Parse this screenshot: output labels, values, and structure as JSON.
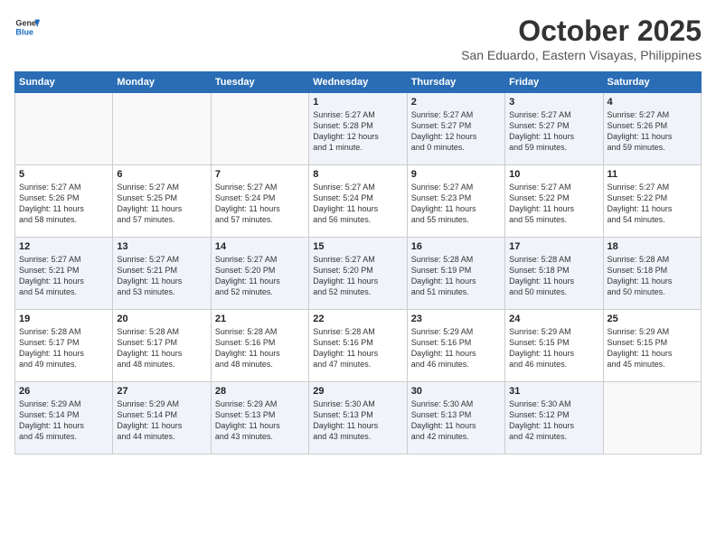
{
  "header": {
    "logo_general": "General",
    "logo_blue": "Blue",
    "month": "October 2025",
    "location": "San Eduardo, Eastern Visayas, Philippines"
  },
  "days_of_week": [
    "Sunday",
    "Monday",
    "Tuesday",
    "Wednesday",
    "Thursday",
    "Friday",
    "Saturday"
  ],
  "weeks": [
    [
      {
        "day": "",
        "info": ""
      },
      {
        "day": "",
        "info": ""
      },
      {
        "day": "",
        "info": ""
      },
      {
        "day": "1",
        "info": "Sunrise: 5:27 AM\nSunset: 5:28 PM\nDaylight: 12 hours\nand 1 minute."
      },
      {
        "day": "2",
        "info": "Sunrise: 5:27 AM\nSunset: 5:27 PM\nDaylight: 12 hours\nand 0 minutes."
      },
      {
        "day": "3",
        "info": "Sunrise: 5:27 AM\nSunset: 5:27 PM\nDaylight: 11 hours\nand 59 minutes."
      },
      {
        "day": "4",
        "info": "Sunrise: 5:27 AM\nSunset: 5:26 PM\nDaylight: 11 hours\nand 59 minutes."
      }
    ],
    [
      {
        "day": "5",
        "info": "Sunrise: 5:27 AM\nSunset: 5:26 PM\nDaylight: 11 hours\nand 58 minutes."
      },
      {
        "day": "6",
        "info": "Sunrise: 5:27 AM\nSunset: 5:25 PM\nDaylight: 11 hours\nand 57 minutes."
      },
      {
        "day": "7",
        "info": "Sunrise: 5:27 AM\nSunset: 5:24 PM\nDaylight: 11 hours\nand 57 minutes."
      },
      {
        "day": "8",
        "info": "Sunrise: 5:27 AM\nSunset: 5:24 PM\nDaylight: 11 hours\nand 56 minutes."
      },
      {
        "day": "9",
        "info": "Sunrise: 5:27 AM\nSunset: 5:23 PM\nDaylight: 11 hours\nand 55 minutes."
      },
      {
        "day": "10",
        "info": "Sunrise: 5:27 AM\nSunset: 5:22 PM\nDaylight: 11 hours\nand 55 minutes."
      },
      {
        "day": "11",
        "info": "Sunrise: 5:27 AM\nSunset: 5:22 PM\nDaylight: 11 hours\nand 54 minutes."
      }
    ],
    [
      {
        "day": "12",
        "info": "Sunrise: 5:27 AM\nSunset: 5:21 PM\nDaylight: 11 hours\nand 54 minutes."
      },
      {
        "day": "13",
        "info": "Sunrise: 5:27 AM\nSunset: 5:21 PM\nDaylight: 11 hours\nand 53 minutes."
      },
      {
        "day": "14",
        "info": "Sunrise: 5:27 AM\nSunset: 5:20 PM\nDaylight: 11 hours\nand 52 minutes."
      },
      {
        "day": "15",
        "info": "Sunrise: 5:27 AM\nSunset: 5:20 PM\nDaylight: 11 hours\nand 52 minutes."
      },
      {
        "day": "16",
        "info": "Sunrise: 5:28 AM\nSunset: 5:19 PM\nDaylight: 11 hours\nand 51 minutes."
      },
      {
        "day": "17",
        "info": "Sunrise: 5:28 AM\nSunset: 5:18 PM\nDaylight: 11 hours\nand 50 minutes."
      },
      {
        "day": "18",
        "info": "Sunrise: 5:28 AM\nSunset: 5:18 PM\nDaylight: 11 hours\nand 50 minutes."
      }
    ],
    [
      {
        "day": "19",
        "info": "Sunrise: 5:28 AM\nSunset: 5:17 PM\nDaylight: 11 hours\nand 49 minutes."
      },
      {
        "day": "20",
        "info": "Sunrise: 5:28 AM\nSunset: 5:17 PM\nDaylight: 11 hours\nand 48 minutes."
      },
      {
        "day": "21",
        "info": "Sunrise: 5:28 AM\nSunset: 5:16 PM\nDaylight: 11 hours\nand 48 minutes."
      },
      {
        "day": "22",
        "info": "Sunrise: 5:28 AM\nSunset: 5:16 PM\nDaylight: 11 hours\nand 47 minutes."
      },
      {
        "day": "23",
        "info": "Sunrise: 5:29 AM\nSunset: 5:16 PM\nDaylight: 11 hours\nand 46 minutes."
      },
      {
        "day": "24",
        "info": "Sunrise: 5:29 AM\nSunset: 5:15 PM\nDaylight: 11 hours\nand 46 minutes."
      },
      {
        "day": "25",
        "info": "Sunrise: 5:29 AM\nSunset: 5:15 PM\nDaylight: 11 hours\nand 45 minutes."
      }
    ],
    [
      {
        "day": "26",
        "info": "Sunrise: 5:29 AM\nSunset: 5:14 PM\nDaylight: 11 hours\nand 45 minutes."
      },
      {
        "day": "27",
        "info": "Sunrise: 5:29 AM\nSunset: 5:14 PM\nDaylight: 11 hours\nand 44 minutes."
      },
      {
        "day": "28",
        "info": "Sunrise: 5:29 AM\nSunset: 5:13 PM\nDaylight: 11 hours\nand 43 minutes."
      },
      {
        "day": "29",
        "info": "Sunrise: 5:30 AM\nSunset: 5:13 PM\nDaylight: 11 hours\nand 43 minutes."
      },
      {
        "day": "30",
        "info": "Sunrise: 5:30 AM\nSunset: 5:13 PM\nDaylight: 11 hours\nand 42 minutes."
      },
      {
        "day": "31",
        "info": "Sunrise: 5:30 AM\nSunset: 5:12 PM\nDaylight: 11 hours\nand 42 minutes."
      },
      {
        "day": "",
        "info": ""
      }
    ]
  ]
}
